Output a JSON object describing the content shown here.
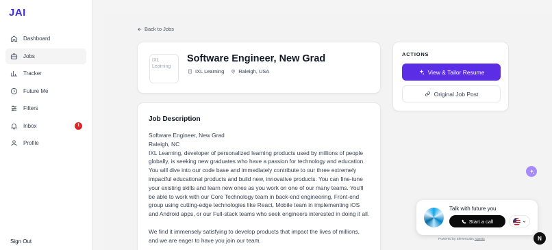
{
  "app": {
    "logo": "JAI"
  },
  "sidebar": {
    "items": [
      {
        "label": "Dashboard",
        "icon": "dashboard-icon"
      },
      {
        "label": "Jobs",
        "icon": "briefcase-icon",
        "active": true
      },
      {
        "label": "Tracker",
        "icon": "chart-icon"
      },
      {
        "label": "Future Me",
        "icon": "clock-icon"
      },
      {
        "label": "Filters",
        "icon": "sliders-icon"
      },
      {
        "label": "Inbox",
        "icon": "bell-icon",
        "badge": "1"
      },
      {
        "label": "Profile",
        "icon": "user-icon"
      }
    ],
    "sign_out": "Sign Out"
  },
  "page": {
    "back_label": "Back to Jobs",
    "logo_alt": "IXL Learning",
    "job_title": "Software Engineer, New Grad",
    "company": "IXL Learning",
    "location": "Raleigh, USA",
    "description_heading": "Job Description",
    "description_paragraphs": [
      "Software Engineer, New Grad\nRaleigh, NC\nIXL Learning, developer of personalized learning products used by millions of people globally, is seeking new graduates who have a passion for technology and education. You will dive into our code base and immediately contribute to our three extremely impactful educational products and build new, innovative products. You can fine-tune your existing skills and learn new ones as you work on one of our many teams. You'll be able to work with our Core Technology team in back-end engineering, Front-end group using cutting-edge technologies like React, Mobile team in implementing iOS and Android apps, or our Full-stack teams who seek engineers interested in doing it all.",
      "We find it immensely satisfying to develop products that impact the lives of millions, and we are eager to have you join our team."
    ]
  },
  "actions": {
    "title": "ACTIONS",
    "primary_label": "View & Tailor Resume",
    "secondary_label": "Original Job Post"
  },
  "voice_widget": {
    "prompt": "Talk with future you",
    "call_label": "Start a call",
    "powered_by": "Powered by ElevenLabs",
    "powered_link": "Agents",
    "language_icon": "us-flag-icon"
  },
  "floating": {
    "n_label": "N"
  },
  "colors": {
    "brand": "#3f2fd8",
    "primary_button": "#5b2ee6",
    "badge": "#dc2626"
  }
}
